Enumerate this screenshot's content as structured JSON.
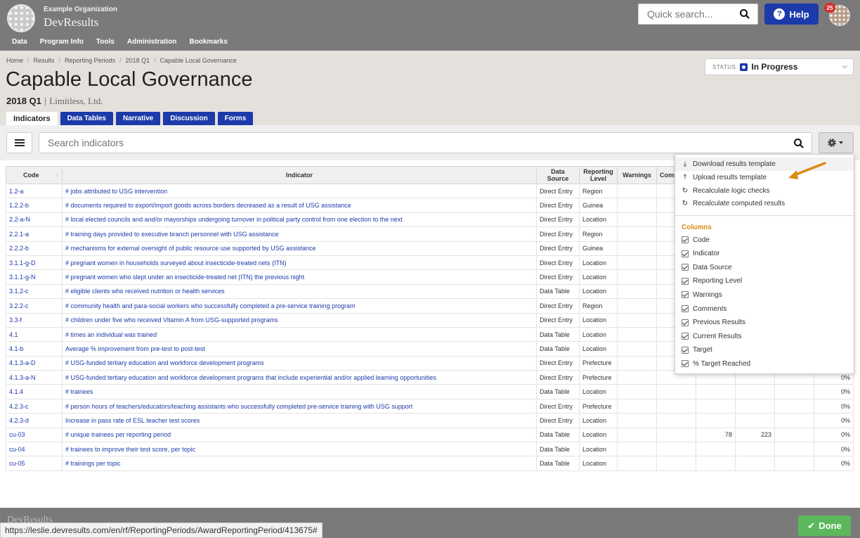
{
  "org": {
    "name": "Example Organization",
    "app": "DevResults"
  },
  "nav": [
    "Data",
    "Program Info",
    "Tools",
    "Administration",
    "Bookmarks"
  ],
  "quick_search": {
    "placeholder": "Quick search..."
  },
  "help_label": "Help",
  "notification_count": "25",
  "breadcrumb": [
    "Home",
    "Results",
    "Reporting Periods",
    "2018 Q1",
    "Capable Local Governance"
  ],
  "page": {
    "title": "Capable Local Governance",
    "period": "2018 Q1",
    "organization": "Limitless, Ltd."
  },
  "status": {
    "label": "STATUS",
    "value": "In Progress",
    "color": "#1c3aa9"
  },
  "tabs": [
    "Indicators",
    "Data Tables",
    "Narrative",
    "Discussion",
    "Forms"
  ],
  "search": {
    "placeholder": "Search indicators"
  },
  "table": {
    "headers": {
      "code": "Code",
      "indicator": "Indicator",
      "data_source": "Data Source",
      "reporting_level": "Reporting Level",
      "warnings": "Warnings",
      "comments": "Comm"
    },
    "rows": [
      {
        "code": "1.2-a",
        "indicator": "# jobs attributed to USG intervention",
        "source": "Direct Entry",
        "level": "Region",
        "prev": "",
        "curr": "",
        "pct": ""
      },
      {
        "code": "1.2.2-b",
        "indicator": "# documents required to export/import goods across borders decreased as a result of USG assistance",
        "source": "Direct Entry",
        "level": "Guinea",
        "prev": "",
        "curr": "",
        "pct": ""
      },
      {
        "code": "2.2-a-N",
        "indicator": "# local elected councils and and/or mayorships undergoing turnover in political party control from one election to the next",
        "source": "Direct Entry",
        "level": "Location",
        "prev": "",
        "curr": "",
        "pct": ""
      },
      {
        "code": "2.2.1-a",
        "indicator": "# training days provided to executive branch personnel with USG assistance",
        "source": "Direct Entry",
        "level": "Region",
        "prev": "",
        "curr": "",
        "pct": ""
      },
      {
        "code": "2.2.2-b",
        "indicator": "# mechanisms for external oversight of public resource use supported by USG assistance",
        "source": "Direct Entry",
        "level": "Guinea",
        "prev": "",
        "curr": "",
        "pct": ""
      },
      {
        "code": "3.1.1-g-D",
        "indicator": "# pregnant women in households surveyed about insecticide-treated nets (ITN)",
        "source": "Direct Entry",
        "level": "Location",
        "prev": "",
        "curr": "",
        "pct": ""
      },
      {
        "code": "3.1.1-g-N",
        "indicator": "# pregnant women who slept under an insecticide-treated net (ITN) the previous night",
        "source": "Direct Entry",
        "level": "Location",
        "prev": "",
        "curr": "",
        "pct": ""
      },
      {
        "code": "3.1.2-c",
        "indicator": "# eligible clients who received nutrition or health services",
        "source": "Data Table",
        "level": "Location",
        "prev": "",
        "curr": "",
        "pct": ""
      },
      {
        "code": "3.2.2-c",
        "indicator": "# community health and para-social workers who successfully completed a pre-service training program",
        "source": "Direct Entry",
        "level": "Region",
        "prev": "",
        "curr": "",
        "pct": ""
      },
      {
        "code": "3.3-f",
        "indicator": "# children under five who received Vitamin A from USG-supported programs",
        "source": "Direct Entry",
        "level": "Location",
        "prev": "",
        "curr": "",
        "pct": ""
      },
      {
        "code": "4.1",
        "indicator": "# times an individual was trained",
        "source": "Data Table",
        "level": "Location",
        "prev": "",
        "curr": "",
        "pct": ""
      },
      {
        "code": "4.1-b",
        "indicator": "Average % improvement from pre-test to post-test",
        "source": "Data Table",
        "level": "Location",
        "prev": "",
        "curr": "",
        "pct": ""
      },
      {
        "code": "4.1.3-a-D",
        "indicator": "# USG-funded tertiary education and workforce development programs",
        "source": "Direct Entry",
        "level": "Prefecture",
        "prev": "",
        "curr": "",
        "pct": ""
      },
      {
        "code": "4.1.3-a-N",
        "indicator": "# USG-funded tertiary education and workforce development programs that include experiential and/or applied learning opportunities",
        "source": "Direct Entry",
        "level": "Prefecture",
        "prev": "",
        "curr": "",
        "pct": "0%"
      },
      {
        "code": "4.1.4",
        "indicator": "# trainees",
        "source": "Data Table",
        "level": "Location",
        "prev": "",
        "curr": "",
        "pct": "0%"
      },
      {
        "code": "4.2.3-c",
        "indicator": "# person hours of teachers/educators/teaching assistants who successfully completed pre-service training with USG support",
        "source": "Direct Entry",
        "level": "Prefecture",
        "prev": "",
        "curr": "",
        "pct": "0%"
      },
      {
        "code": "4.2.3-d",
        "indicator": "Increase in pass rate of ESL teacher test scores",
        "source": "Direct Entry",
        "level": "Location",
        "prev": "",
        "curr": "",
        "pct": "0%"
      },
      {
        "code": "cu-03",
        "indicator": "# unique trainees per reporting period",
        "source": "Data Table",
        "level": "Location",
        "prev": "78",
        "curr": "223",
        "pct": "0%"
      },
      {
        "code": "cu-04",
        "indicator": "# trainees to improve their test score, per topic",
        "source": "Data Table",
        "level": "Location",
        "prev": "",
        "curr": "",
        "pct": "0%"
      },
      {
        "code": "cu-05",
        "indicator": "# trainings per topic",
        "source": "Data Table",
        "level": "Location",
        "prev": "",
        "curr": "",
        "pct": "0%"
      }
    ]
  },
  "dropdown": {
    "actions": [
      {
        "label": "Download results template",
        "icon": "download-icon"
      },
      {
        "label": "Upload results template",
        "icon": "upload-icon"
      },
      {
        "label": "Recalculate logic checks",
        "icon": "refresh-icon"
      },
      {
        "label": "Recalculate computed results",
        "icon": "refresh-icon"
      }
    ],
    "columns_heading": "Columns",
    "columns": [
      "Code",
      "Indicator",
      "Data Source",
      "Reporting Level",
      "Warnings",
      "Comments",
      "Previous Results",
      "Current Results",
      "Target",
      "% Target Reached"
    ]
  },
  "footer": {
    "logo": "DevResults",
    "done_label": "Done"
  },
  "status_url": "https://leslie.devresults.com/en/rf/ReportingPeriods/AwardReportingPeriod/413675#",
  "colors": {
    "brand_blue": "#1c3aa9",
    "accent_orange": "#d98b14",
    "done_green": "#5cb85c"
  }
}
